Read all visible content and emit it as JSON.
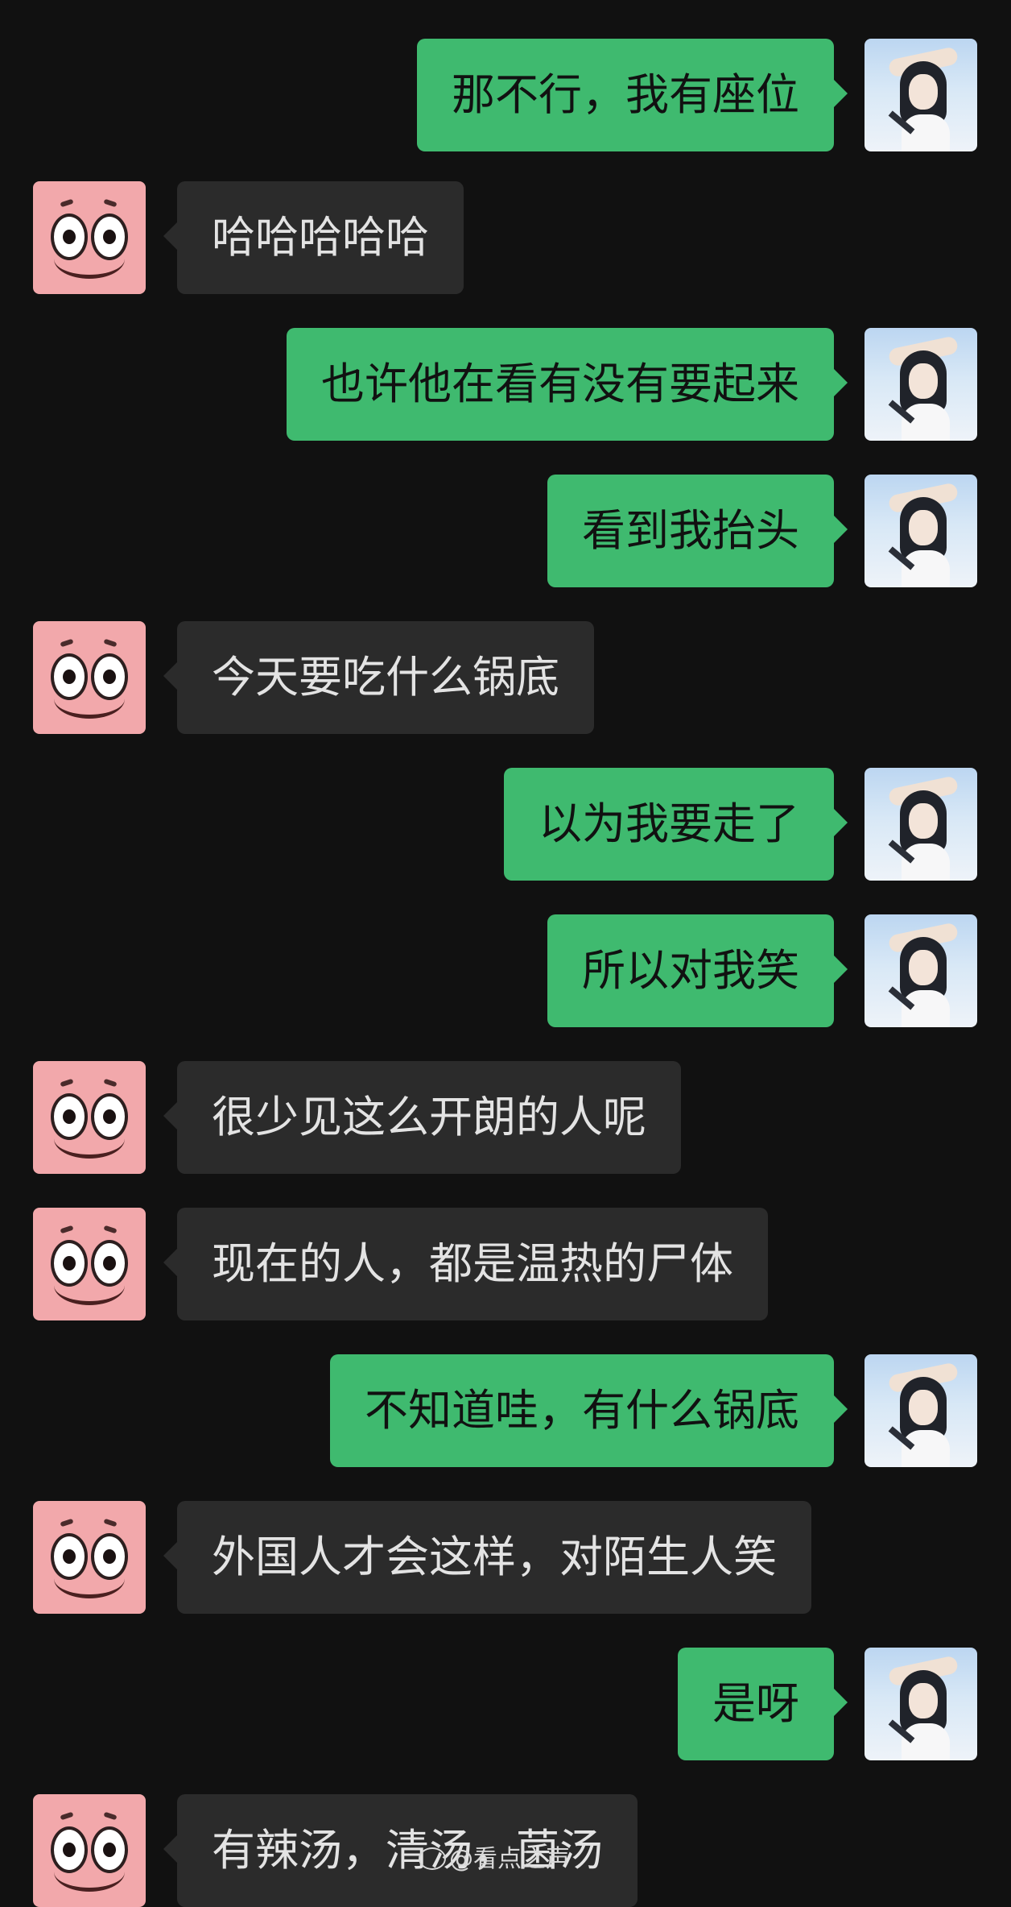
{
  "colors": {
    "background": "#111111",
    "incoming_bubble": "#2b2b2b",
    "incoming_text": "#e3e3e3",
    "outgoing_bubble": "#3fba6f",
    "outgoing_text": "#111111",
    "contact_avatar": "#f2a8ab"
  },
  "avatars": {
    "contact": "patrick-star-avatar",
    "self": "girl-photo-avatar"
  },
  "messages": [
    {
      "sender": "self",
      "text": "那不行，我有座位"
    },
    {
      "sender": "contact",
      "text": "哈哈哈哈哈"
    },
    {
      "sender": "self",
      "text": "也许他在看有没有要起来"
    },
    {
      "sender": "self",
      "text": "看到我抬头"
    },
    {
      "sender": "contact",
      "text": "今天要吃什么锅底"
    },
    {
      "sender": "self",
      "text": "以为我要走了"
    },
    {
      "sender": "self",
      "text": "所以对我笑"
    },
    {
      "sender": "contact",
      "text": "很少见这么开朗的人呢"
    },
    {
      "sender": "contact",
      "text": "现在的人，都是温热的尸体"
    },
    {
      "sender": "self",
      "text": "不知道哇，有什么锅底"
    },
    {
      "sender": "contact",
      "text": "外国人才会这样，对陌生人笑"
    },
    {
      "sender": "self",
      "text": "是呀"
    },
    {
      "sender": "contact",
      "text": "有辣汤，清汤，菌汤"
    }
  ],
  "watermark": {
    "text": "@看点之声"
  }
}
